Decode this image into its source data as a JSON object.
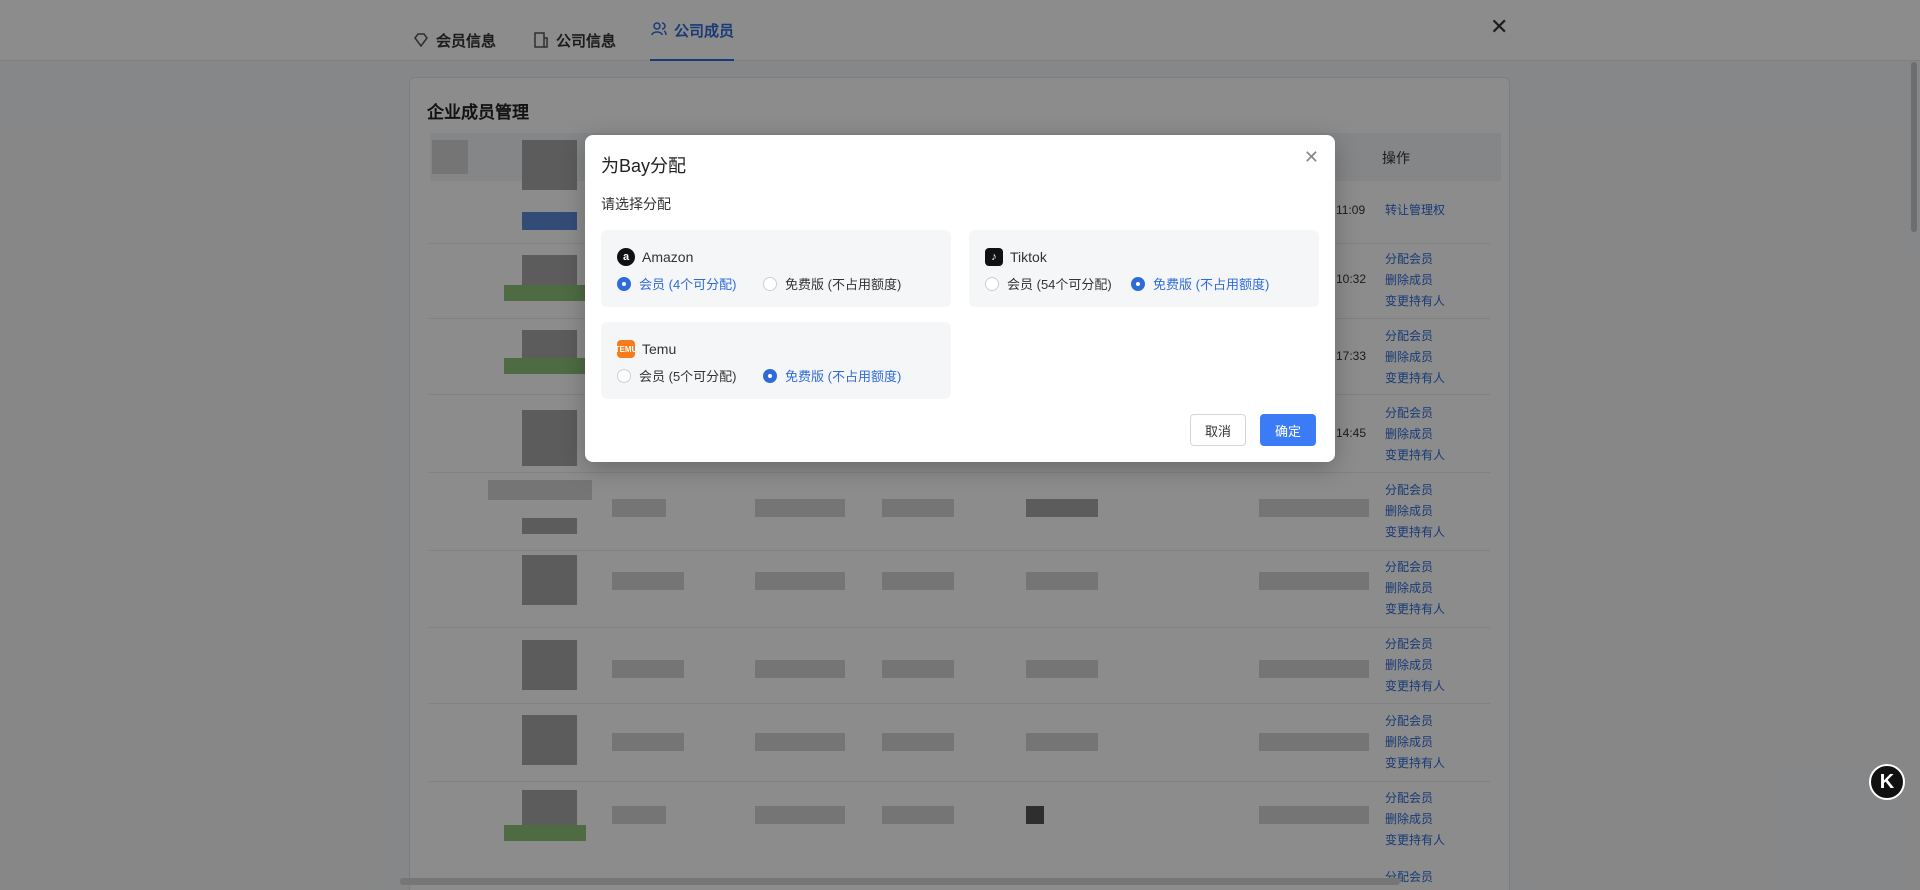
{
  "tabs": [
    {
      "label": "会员信息",
      "icon": "diamond-icon"
    },
    {
      "label": "公司信息",
      "icon": "building-icon"
    },
    {
      "label": "公司成员",
      "icon": "users-icon"
    }
  ],
  "page": {
    "title": "企业成员管理",
    "op_header": "操作"
  },
  "rows": [
    {
      "time": "11:09",
      "ops": [
        "转让管理权"
      ]
    },
    {
      "time": "10:32",
      "ops": [
        "分配会员",
        "删除成员",
        "变更持有人"
      ]
    },
    {
      "time": "17:33",
      "ops": [
        "分配会员",
        "删除成员",
        "变更持有人"
      ]
    },
    {
      "time": "14:45",
      "ops": [
        "分配会员",
        "删除成员",
        "变更持有人"
      ]
    },
    {
      "time": "",
      "ops": [
        "分配会员",
        "删除成员",
        "变更持有人"
      ]
    },
    {
      "time": "",
      "ops": [
        "分配会员",
        "删除成员",
        "变更持有人"
      ]
    },
    {
      "time": "",
      "ops": [
        "分配会员",
        "删除成员",
        "变更持有人"
      ]
    },
    {
      "time": "",
      "ops": [
        "分配会员",
        "删除成员",
        "变更持有人"
      ]
    },
    {
      "time": "",
      "ops": [
        "分配会员",
        "删除成员",
        "变更持有人"
      ]
    },
    {
      "time": "",
      "ops": [
        "分配会员"
      ]
    }
  ],
  "float_button": "K",
  "modal": {
    "title": "为Bay分配",
    "subtitle": "请选择分配",
    "platforms": [
      {
        "name": "Amazon",
        "logo": "a",
        "options": [
          {
            "label": "会员 (4个可分配)",
            "selected": true
          },
          {
            "label": "免费版 (不占用额度)",
            "selected": false
          }
        ]
      },
      {
        "name": "Tiktok",
        "logo": "♪",
        "options": [
          {
            "label": "会员 (54个可分配)",
            "selected": false
          },
          {
            "label": "免费版 (不占用额度)",
            "selected": true
          }
        ]
      },
      {
        "name": "Temu",
        "logo": "TEMU",
        "options": [
          {
            "label": "会员 (5个可分配)",
            "selected": false
          },
          {
            "label": "免费版 (不占用额度)",
            "selected": true
          }
        ]
      }
    ],
    "cancel_label": "取消",
    "ok_label": "确定"
  },
  "colors": {
    "accent": "#3b7cf6",
    "link": "#2f6bd8",
    "temu": "#f77a1c"
  }
}
